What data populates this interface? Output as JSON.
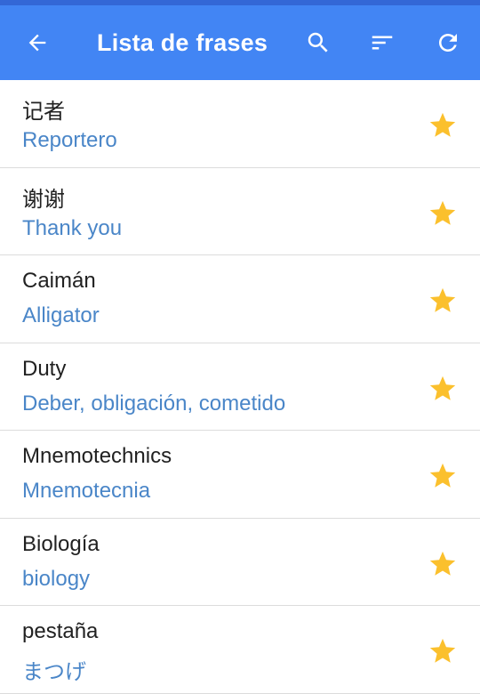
{
  "app": {
    "title": "Lista de frases",
    "header_color": "#4285f4",
    "status_bar_color": "#3367d6",
    "icons": [
      "back-arrow-icon",
      "search-icon",
      "sort-icon",
      "refresh-icon"
    ]
  },
  "colors": {
    "phrase_text": "#212121",
    "translation_text": "#4a86c8",
    "star": "#fbc02d",
    "divider": "#dcdcdc"
  },
  "phrases": [
    {
      "phrase": "记者",
      "translation": "Reportero",
      "starred": true
    },
    {
      "phrase": "谢谢",
      "translation": "Thank you",
      "starred": true
    },
    {
      "phrase": "Caimán",
      "translation": "Alligator",
      "starred": true
    },
    {
      "phrase": "Duty",
      "translation": "Deber, obligación, cometido",
      "starred": true
    },
    {
      "phrase": "Mnemotechnics",
      "translation": "Mnemotecnia",
      "starred": true
    },
    {
      "phrase": "Biología",
      "translation": "biology",
      "starred": true
    },
    {
      "phrase": "pestaña",
      "translation": "まつげ",
      "starred": true
    }
  ]
}
